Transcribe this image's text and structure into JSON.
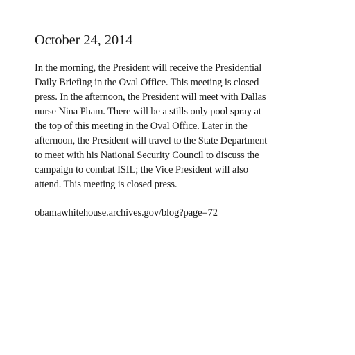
{
  "post": {
    "date": "October 24, 2014",
    "body_lines": [
      "In the morning, the President will receive the Presidential",
      "Daily Briefing in the Oval Office. This meeting is closed",
      "press. In the afternoon, the President will meet with Dallas",
      "nurse Nina Pham. There will be a stills only pool spray at",
      "the top of this meeting in the Oval Office. Later in the",
      "afternoon, the President will travel to the State Department",
      "to meet with his National Security Council to discuss the",
      "campaign to combat ISIL; the Vice President will also",
      "attend. This meeting is closed press."
    ],
    "source": "obamawhitehouse.archives.gov/blog?page=72"
  }
}
